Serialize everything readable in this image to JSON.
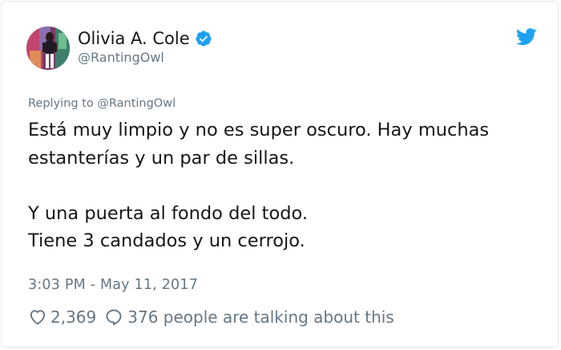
{
  "tweet": {
    "author": {
      "display_name": "Olivia A. Cole",
      "handle": "@RantingOwl",
      "verified": true
    },
    "replying_to": "Replying to @RantingOwl",
    "paragraph1": [
      "Está muy limpio y no es super oscuro. Hay muchas",
      "estanterías y un par de sillas."
    ],
    "paragraph2": [
      "Y una puerta al fondo del todo.",
      "Tiene 3 candados y un cerrojo."
    ],
    "timestamp": "3:03 PM - May 11, 2017",
    "likes": "2,369",
    "talking": "376 people are talking about this"
  },
  "colors": {
    "twitter_blue": "#1da1f2",
    "verified_blue": "#1da1f2",
    "secondary_text": "#657786",
    "border": "#e1e8ed"
  },
  "icons": {
    "brand": "twitter-bird-icon",
    "verified": "verified-badge-icon",
    "like": "heart-icon",
    "reply": "speech-bubble-icon"
  }
}
